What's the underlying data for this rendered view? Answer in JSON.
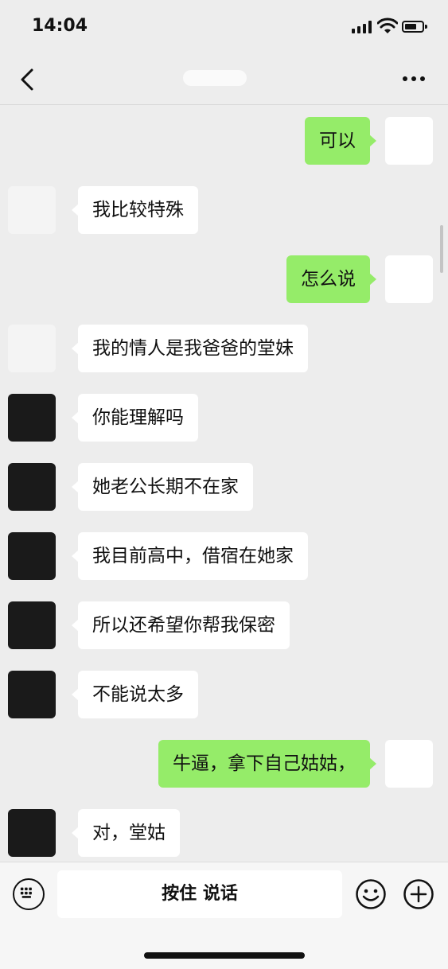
{
  "status_bar": {
    "time": "14:04"
  },
  "nav": {
    "title": ""
  },
  "messages": [
    {
      "side": "out",
      "text": "可以"
    },
    {
      "side": "in",
      "text": "我比较特殊"
    },
    {
      "side": "out",
      "text": "怎么说"
    },
    {
      "side": "in",
      "text": "我的情人是我爸爸的堂妹"
    },
    {
      "side": "in",
      "text": "你能理解吗"
    },
    {
      "side": "in",
      "text": "她老公长期不在家"
    },
    {
      "side": "in",
      "text": "我目前高中，借宿在她家"
    },
    {
      "side": "in",
      "text": "所以还希望你帮我保密"
    },
    {
      "side": "in",
      "text": "不能说太多"
    },
    {
      "side": "out",
      "text": "牛逼，拿下自己姑姑，"
    },
    {
      "side": "in",
      "text": "对，堂姑"
    }
  ],
  "input": {
    "hold_to_talk_label": "按住 说话"
  },
  "icons": {
    "back": "chevron-left-icon",
    "more": "more-dots-icon",
    "voice": "keyboard-icon",
    "emoji": "emoji-icon",
    "plus": "plus-icon"
  },
  "colors": {
    "outgoing_bubble": "#95ec69",
    "incoming_bubble": "#ffffff",
    "background": "#ededed"
  }
}
